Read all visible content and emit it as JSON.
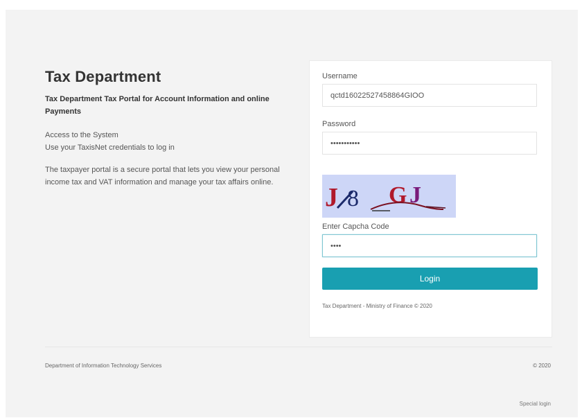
{
  "info": {
    "title": "Tax Department",
    "subtitle": "Tax Department Tax Portal for Account Information and online Payments",
    "access_line1": "Access to the System",
    "access_line2": "Use your TaxisNet credentials to log in",
    "description": "The taxpayer portal is a secure portal that lets you view your personal income tax and VAT information and manage your tax affairs online."
  },
  "form": {
    "username_label": "Username",
    "username_value": "qctd16022527458864GIOO",
    "password_label": "Password",
    "password_value": "•••••••••••",
    "captcha_text": "J 8  GJ",
    "captcha_label": "Enter Capcha Code",
    "captcha_value": "••••",
    "login_label": "Login",
    "card_note": "Tax Department - Ministry of Finance © 2020"
  },
  "footer": {
    "left": "Department of Information Technology Services",
    "right": "© 2020",
    "special_login": "Special login"
  },
  "colors": {
    "accent": "#199fb1",
    "captcha_bg": "#cdd6f7",
    "captcha_red": "#b0192b"
  }
}
